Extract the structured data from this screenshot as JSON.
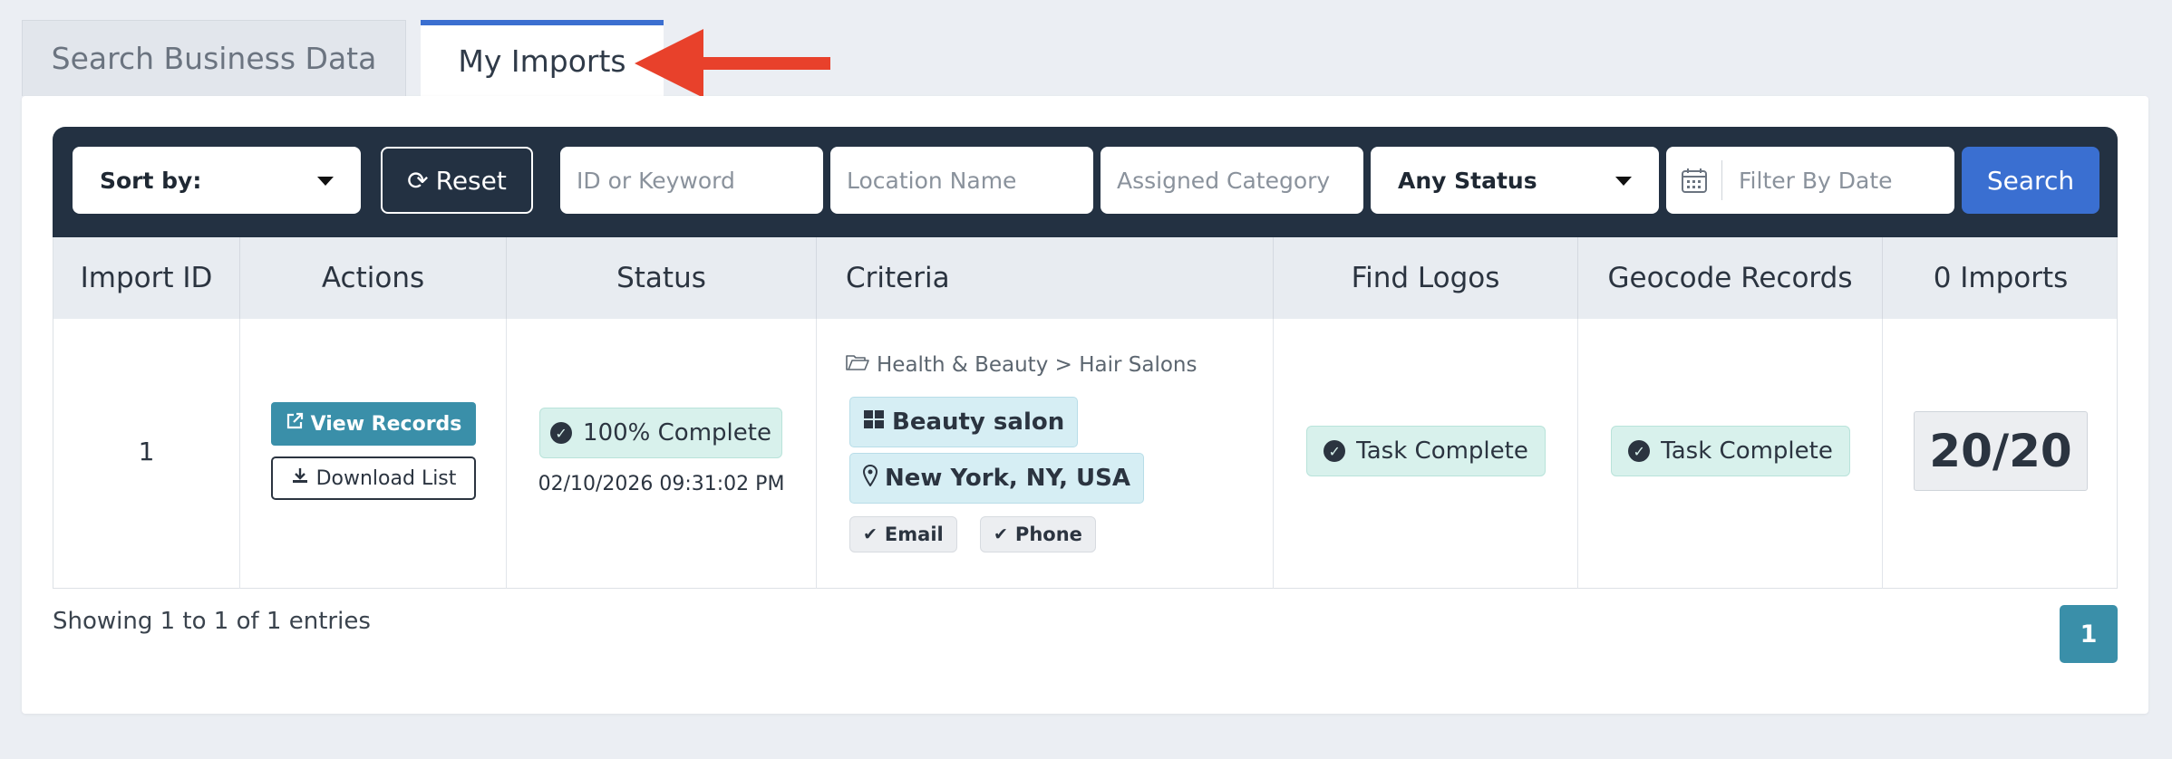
{
  "tabs": [
    {
      "label": "Search Business Data",
      "active": false
    },
    {
      "label": "My Imports",
      "active": true
    }
  ],
  "filters": {
    "sort_label": "Sort by:",
    "reset_label": "Reset",
    "id_placeholder": "ID or Keyword",
    "location_placeholder": "Location Name",
    "category_placeholder": "Assigned Category",
    "status_label": "Any Status",
    "date_placeholder": "Filter By Date",
    "search_label": "Search"
  },
  "table": {
    "headers": [
      "Import ID",
      "Actions",
      "Status",
      "Criteria",
      "Find Logos",
      "Geocode Records",
      "0 Imports"
    ],
    "rows": [
      {
        "import_id": "1",
        "view_label": "View Records",
        "download_label": "Download List",
        "status": "100% Complete",
        "date": "02/10/2026 09:31:02 PM",
        "category_path": "Health & Beauty > Hair Salons",
        "keyword": "Beauty salon",
        "location": "New York, NY, USA",
        "tags": [
          "Email",
          "Phone"
        ],
        "find_logos": "Task Complete",
        "geocode": "Task Complete",
        "imports": "20/20"
      }
    ]
  },
  "footer": {
    "info": "Showing 1 to 1 of 1 entries",
    "page": "1"
  },
  "colors": {
    "accent_blue": "#3a6fd1",
    "teal": "#3a8fa9",
    "dark_bar": "#233142",
    "arrow": "#e8412b"
  }
}
